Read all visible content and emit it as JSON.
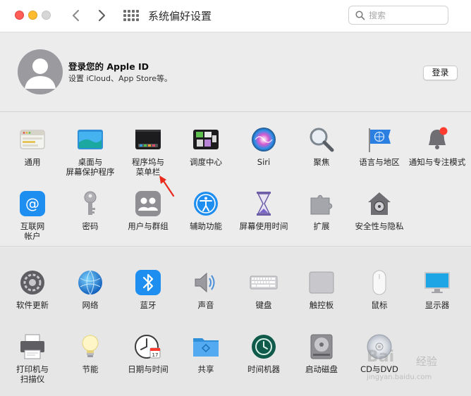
{
  "window": {
    "title": "系统偏好设置",
    "traffic_lights": [
      "close",
      "minimize",
      "zoom"
    ]
  },
  "search": {
    "placeholder": "搜索"
  },
  "account": {
    "title": "登录您的 Apple ID",
    "subtitle": "设置 iCloud、App Store等。",
    "login_label": "登录"
  },
  "section1": [
    {
      "label": "通用",
      "icon": "general-icon"
    },
    {
      "label": "桌面与\n屏幕保护程序",
      "icon": "desktop-screensaver-icon"
    },
    {
      "label": "程序坞与\n菜单栏",
      "icon": "dock-menubar-icon"
    },
    {
      "label": "调度中心",
      "icon": "mission-control-icon"
    },
    {
      "label": "Siri",
      "icon": "siri-icon"
    },
    {
      "label": "聚焦",
      "icon": "spotlight-icon"
    },
    {
      "label": "语言与地区",
      "icon": "language-region-icon"
    },
    {
      "label": "通知与专注模式",
      "icon": "notifications-focus-icon"
    },
    {
      "label": "互联网\n帐户",
      "icon": "internet-accounts-icon"
    },
    {
      "label": "密码",
      "icon": "passwords-icon"
    },
    {
      "label": "用户与群组",
      "icon": "users-groups-icon"
    },
    {
      "label": "辅助功能",
      "icon": "accessibility-icon"
    },
    {
      "label": "屏幕使用时间",
      "icon": "screen-time-icon"
    },
    {
      "label": "扩展",
      "icon": "extensions-icon"
    },
    {
      "label": "安全性与隐私",
      "icon": "security-privacy-icon"
    }
  ],
  "section2": [
    {
      "label": "软件更新",
      "icon": "software-update-icon"
    },
    {
      "label": "网络",
      "icon": "network-icon"
    },
    {
      "label": "蓝牙",
      "icon": "bluetooth-icon"
    },
    {
      "label": "声音",
      "icon": "sound-icon"
    },
    {
      "label": "键盘",
      "icon": "keyboard-icon"
    },
    {
      "label": "触控板",
      "icon": "trackpad-icon"
    },
    {
      "label": "鼠标",
      "icon": "mouse-icon"
    },
    {
      "label": "显示器",
      "icon": "displays-icon"
    },
    {
      "label": "打印机与\n扫描仪",
      "icon": "printers-scanners-icon"
    },
    {
      "label": "节能",
      "icon": "energy-saver-icon"
    },
    {
      "label": "日期与时间",
      "icon": "date-time-icon"
    },
    {
      "label": "共享",
      "icon": "sharing-icon"
    },
    {
      "label": "时间机器",
      "icon": "time-machine-icon"
    },
    {
      "label": "启动磁盘",
      "icon": "startup-disk-icon"
    },
    {
      "label": "CD与DVD",
      "icon": "cd-dvd-icon"
    }
  ],
  "calendar_icon": {
    "day": "17"
  },
  "watermark": {
    "logo": "Bai",
    "text": "经验",
    "url": "jingyan.baidu.com"
  },
  "colors": {
    "annotation_arrow": "#e8291c",
    "close": "#ff5f57",
    "minimize": "#febc2e"
  }
}
